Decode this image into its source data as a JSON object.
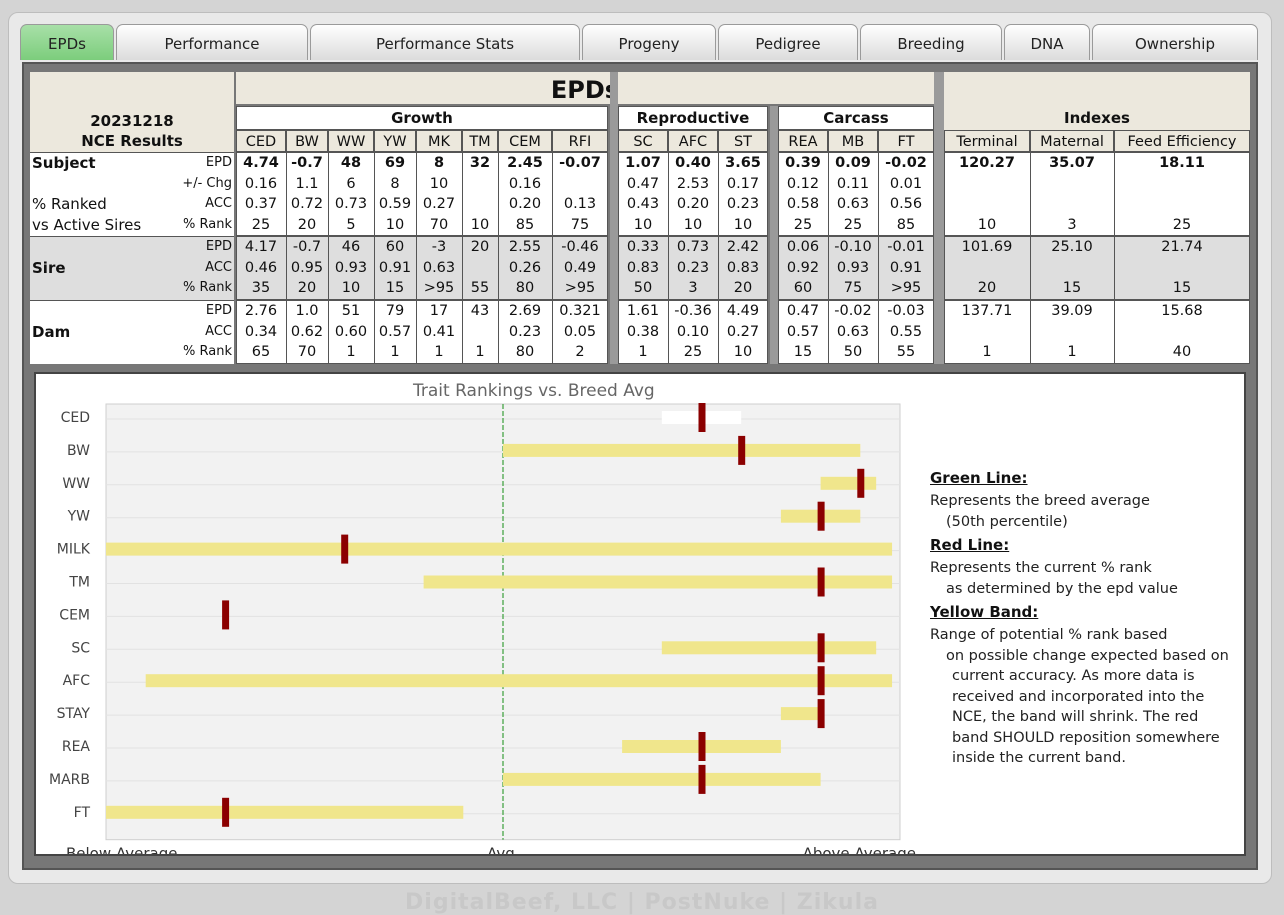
{
  "tabs": [
    "EPDs",
    "Performance",
    "Performance Stats",
    "Progeny",
    "Pedigree",
    "Breeding",
    "DNA",
    "Ownership"
  ],
  "active_tab": "EPDs",
  "table": {
    "title": "EPDs",
    "date": "20231218",
    "subtitle": "NCE Results",
    "groups": {
      "growth": "Growth",
      "reproductive": "Reproductive",
      "carcass": "Carcass",
      "indexes": "Indexes"
    },
    "trait_headers": [
      "CED",
      "BW",
      "WW",
      "YW",
      "MK",
      "TM",
      "CEM",
      "RFI",
      "SC",
      "AFC",
      "ST",
      "REA",
      "MB",
      "FT"
    ],
    "index_headers": [
      "Terminal",
      "Maternal",
      "Feed Efficiency"
    ],
    "rows": [
      {
        "label": "Subject",
        "row_label": "EPD",
        "bold": true,
        "values": [
          "4.74",
          "-0.7",
          "48",
          "69",
          "8",
          "32",
          "2.45",
          "-0.07",
          "1.07",
          "0.40",
          "3.65",
          "0.39",
          "0.09",
          "-0.02"
        ],
        "indexes": [
          "120.27",
          "35.07",
          "18.11"
        ]
      },
      {
        "label": "",
        "row_label": "+/- Chg",
        "bold": false,
        "values": [
          "0.16",
          "1.1",
          "6",
          "8",
          "10",
          "",
          "0.16",
          "",
          "0.47",
          "2.53",
          "0.17",
          "0.12",
          "0.11",
          "0.01"
        ],
        "indexes": [
          "",
          "",
          ""
        ]
      },
      {
        "label": "% Ranked",
        "row_label": "ACC",
        "bold": false,
        "values": [
          "0.37",
          "0.72",
          "0.73",
          "0.59",
          "0.27",
          "",
          "0.20",
          "0.13",
          "0.43",
          "0.20",
          "0.23",
          "0.58",
          "0.63",
          "0.56"
        ],
        "indexes": [
          "",
          "",
          ""
        ]
      },
      {
        "label": "vs Active Sires",
        "row_label": "% Rank",
        "bold": false,
        "values": [
          "25",
          "20",
          "5",
          "10",
          "70",
          "10",
          "85",
          "75",
          "10",
          "10",
          "10",
          "25",
          "25",
          "85"
        ],
        "indexes": [
          "10",
          "3",
          "25"
        ]
      },
      {
        "label": "",
        "row_label": "EPD",
        "bold": false,
        "values": [
          "4.17",
          "-0.7",
          "46",
          "60",
          "-3",
          "20",
          "2.55",
          "-0.46",
          "0.33",
          "0.73",
          "2.42",
          "0.06",
          "-0.10",
          "-0.01"
        ],
        "indexes": [
          "101.69",
          "25.10",
          "21.74"
        ]
      },
      {
        "label": "Sire",
        "row_label": "ACC",
        "bold": false,
        "values": [
          "0.46",
          "0.95",
          "0.93",
          "0.91",
          "0.63",
          "",
          "0.26",
          "0.49",
          "0.83",
          "0.23",
          "0.83",
          "0.92",
          "0.93",
          "0.91"
        ],
        "indexes": [
          "",
          "",
          ""
        ]
      },
      {
        "label": "",
        "row_label": "% Rank",
        "bold": false,
        "values": [
          "35",
          "20",
          "10",
          "15",
          ">95",
          "55",
          "80",
          ">95",
          "50",
          "3",
          "20",
          "60",
          "75",
          ">95"
        ],
        "indexes": [
          "20",
          "15",
          "15"
        ]
      },
      {
        "label": "",
        "row_label": "EPD",
        "bold": false,
        "values": [
          "2.76",
          "1.0",
          "51",
          "79",
          "17",
          "43",
          "2.69",
          "0.321",
          "1.61",
          "-0.36",
          "4.49",
          "0.47",
          "-0.02",
          "-0.03"
        ],
        "indexes": [
          "137.71",
          "39.09",
          "15.68"
        ]
      },
      {
        "label": "Dam",
        "row_label": "ACC",
        "bold": false,
        "values": [
          "0.34",
          "0.62",
          "0.60",
          "0.57",
          "0.41",
          "",
          "0.23",
          "0.05",
          "0.38",
          "0.10",
          "0.27",
          "0.57",
          "0.63",
          "0.55"
        ],
        "indexes": [
          "",
          "",
          ""
        ]
      },
      {
        "label": "",
        "row_label": "% Rank",
        "bold": false,
        "values": [
          "65",
          "70",
          "1",
          "1",
          "1",
          "1",
          "80",
          "2",
          "1",
          "25",
          "10",
          "15",
          "50",
          "55"
        ],
        "indexes": [
          "1",
          "1",
          "40"
        ]
      }
    ]
  },
  "chart": {
    "title": "Trait Rankings vs. Breed Avg",
    "x_left_label": "Below Average",
    "x_mid_label": "Avg",
    "x_right_label": "Above Average",
    "colors": {
      "band": "#f0e68c",
      "marker": "#8b0000",
      "avg_line": "#3aa03a"
    }
  },
  "chart_data": {
    "type": "bar",
    "title": "Trait Rankings vs. Breed Avg",
    "categories": [
      "CED",
      "BW",
      "WW",
      "YW",
      "MILK",
      "TM",
      "CEM",
      "SC",
      "AFC",
      "STAY",
      "REA",
      "MARB",
      "FT"
    ],
    "scale": "percentile position, 0 = Below Average (left), 0.5 = Avg, 1 = Above Average (right)",
    "band_low": [
      0.7,
      0.5,
      0.9,
      0.85,
      0.0,
      0.4,
      null,
      0.7,
      0.05,
      0.85,
      0.65,
      0.5,
      0.0
    ],
    "band_high": [
      0.8,
      0.95,
      0.97,
      0.95,
      0.99,
      0.99,
      null,
      0.97,
      0.99,
      0.9,
      0.85,
      0.9,
      0.45
    ],
    "marker": [
      0.75,
      0.8,
      0.95,
      0.9,
      0.3,
      0.9,
      0.15,
      0.9,
      0.9,
      0.9,
      0.75,
      0.75,
      0.15
    ],
    "band_white": [
      true,
      false,
      false,
      false,
      false,
      false,
      false,
      false,
      false,
      false,
      false,
      false,
      false
    ]
  },
  "legend": {
    "green_title": "Green Line:",
    "green_text": [
      "Represents the breed average",
      "(50th percentile)"
    ],
    "red_title": "Red Line:",
    "red_text": [
      "Represents the current % rank",
      "as determined by the epd value"
    ],
    "yellow_title": "Yellow Band:",
    "yellow_text": [
      "Range of potential % rank based",
      "on possible change expected based on",
      "current accuracy. As more data is",
      "received and incorporated into the",
      "NCE, the band will shrink. The red",
      "band SHOULD reposition somewhere",
      "inside the current band."
    ]
  },
  "footer": "DigitalBeef, LLC | PostNuke | Zikula"
}
